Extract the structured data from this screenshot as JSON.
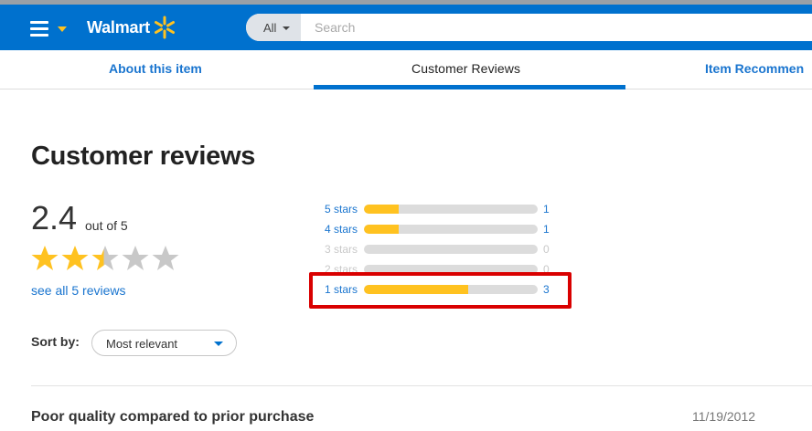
{
  "header": {
    "logo_text": "Walmart",
    "search_category": "All",
    "search_placeholder": "Search",
    "accent_color": "#0071ce",
    "spark_color": "#ffc220"
  },
  "tabs": [
    {
      "label": "About this item"
    },
    {
      "label": "Customer Reviews"
    },
    {
      "label": "Item Recommen"
    }
  ],
  "reviews": {
    "heading": "Customer reviews",
    "average": "2.4",
    "out_of": "out of 5",
    "rating_value": 2.4,
    "see_all": "see all 5 reviews",
    "histogram": [
      {
        "label": "5 stars",
        "count": "1",
        "fraction": 0.2
      },
      {
        "label": "4 stars",
        "count": "1",
        "fraction": 0.2
      },
      {
        "label": "3 stars",
        "count": "0",
        "fraction": 0
      },
      {
        "label": "2 stars",
        "count": "0",
        "fraction": 0
      },
      {
        "label": "1 stars",
        "count": "3",
        "fraction": 0.6
      }
    ],
    "sort_label": "Sort by:",
    "sort_value": "Most relevant",
    "first_review": {
      "title": "Poor quality compared to prior purchase",
      "date": "11/19/2012"
    }
  }
}
